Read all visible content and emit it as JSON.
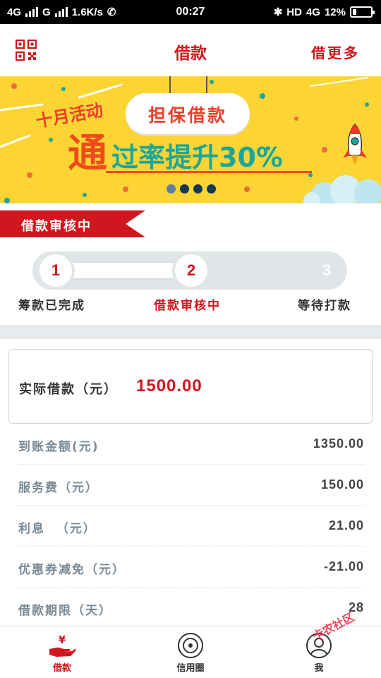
{
  "status_bar": {
    "network1": "4G",
    "network2": "G",
    "speed": "1.6K/s",
    "time": "00:27",
    "hd": "HD",
    "network3": "4G",
    "battery": "12%"
  },
  "header": {
    "title": "借款",
    "more_label": "借更多"
  },
  "banner": {
    "tag": "十月活动",
    "cloud_text": "担保借款",
    "big_char": "通",
    "headline": "过率提升30%",
    "carousel_count": 4,
    "active_index": 0
  },
  "section_title": "借款审核中",
  "progress": {
    "current_step": 2,
    "steps": [
      {
        "num": "1",
        "label": "筹款已完成"
      },
      {
        "num": "2",
        "label": "借款审核中"
      },
      {
        "num": "3",
        "label": "等待打款"
      }
    ]
  },
  "amount_card": {
    "label": "实际借款（元）",
    "value": "1500.00"
  },
  "details": [
    {
      "label": "到账金额(元)",
      "value": "1350.00"
    },
    {
      "label": "服务费（元）",
      "value": "150.00"
    },
    {
      "label": "利息  （元）",
      "value": "21.00"
    },
    {
      "label": "优惠券减免（元）",
      "value": "-21.00"
    },
    {
      "label": "借款期限（天）",
      "value": "28"
    }
  ],
  "tabs": [
    {
      "label": "借款",
      "icon": "yen-hand-icon"
    },
    {
      "label": "信用圈",
      "icon": "credit-circle-icon"
    },
    {
      "label": "我",
      "icon": "user-icon"
    }
  ],
  "watermark": "卡农社区",
  "colors": {
    "brand_red": "#d0161e",
    "banner_yellow": "#fcd535",
    "banner_teal": "#1aa69c",
    "banner_orange": "#ef4a1c",
    "muted_label": "#7a8a96"
  }
}
